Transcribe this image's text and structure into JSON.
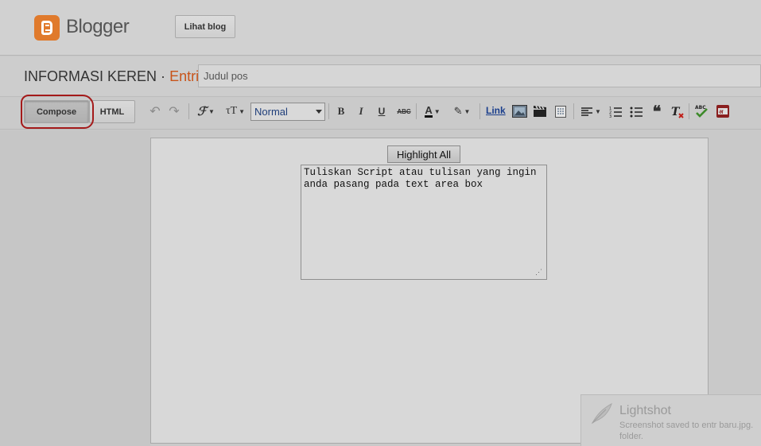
{
  "header": {
    "brand": "Blogger",
    "view_blog_label": "Lihat blog"
  },
  "post": {
    "blog_name": "INFORMASI KEREN",
    "separator": "·",
    "section": "Entri",
    "title_placeholder": "Judul pos"
  },
  "toolbar": {
    "compose_label": "Compose",
    "html_label": "HTML",
    "font_size_value": "Normal",
    "link_label": "Link"
  },
  "editor": {
    "highlight_label": "Highlight All",
    "textarea_text": "Tuliskan Script atau tulisan yang ingin anda pasang pada text area box"
  },
  "notification": {
    "app": "Lightshot",
    "line1": "Screenshot saved to entr baru.jpg.",
    "line2": "folder."
  },
  "colors": {
    "brand_orange": "#e07a2c",
    "annotation_red": "#a41a1a",
    "link_blue": "#1a3e8c"
  }
}
